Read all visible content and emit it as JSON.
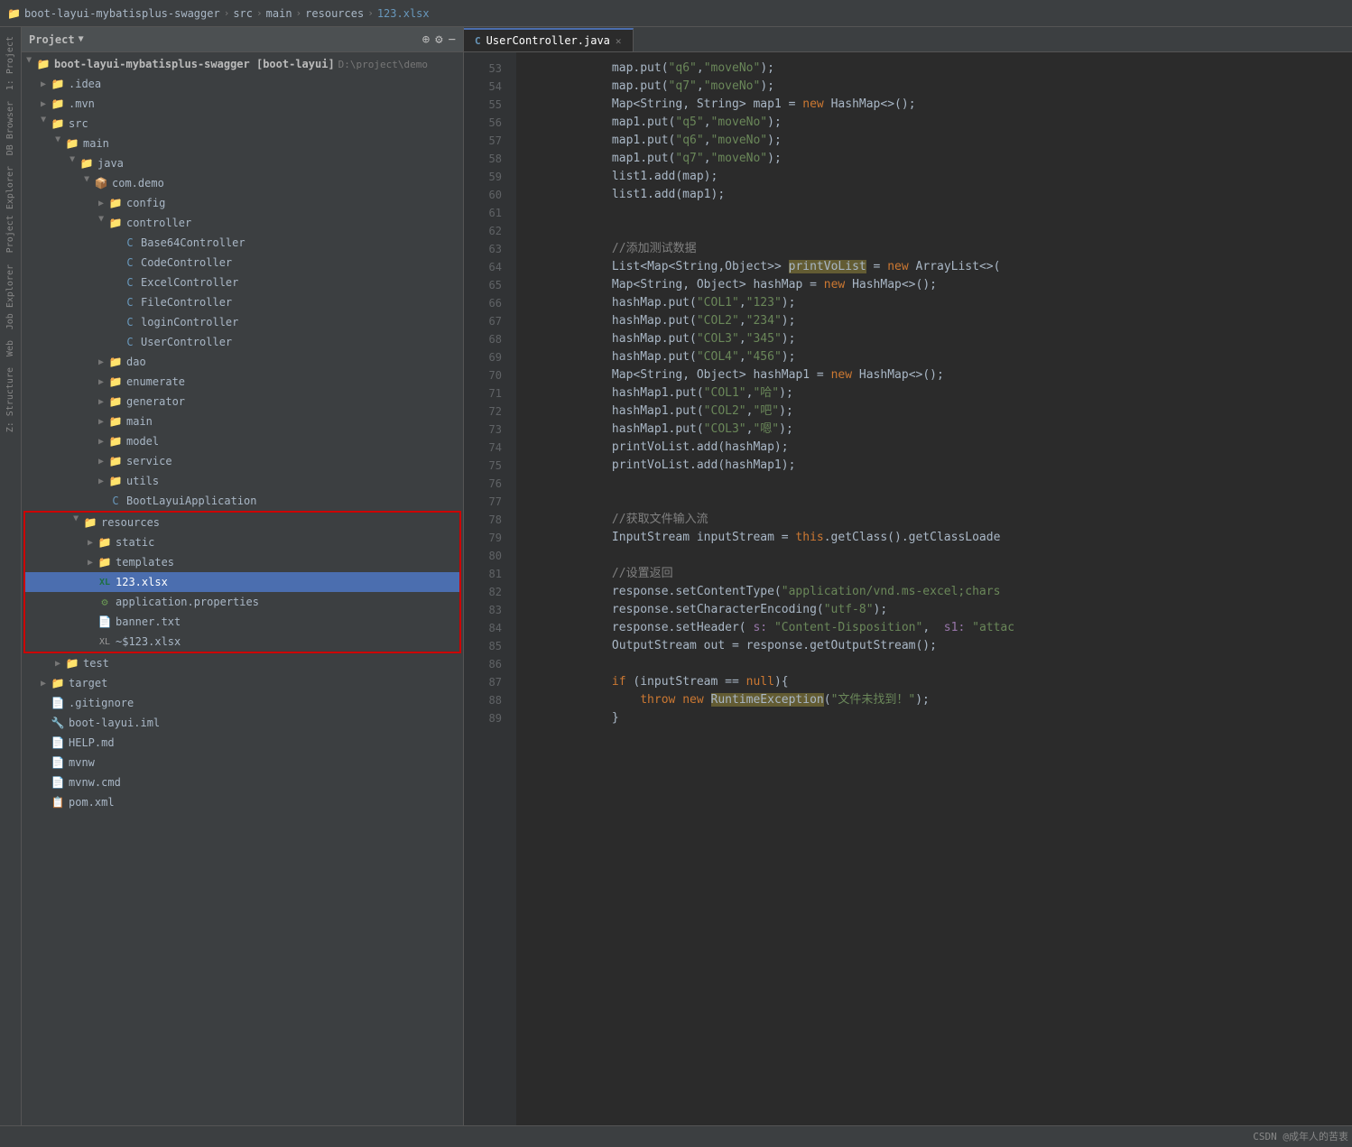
{
  "breadcrumb": {
    "items": [
      {
        "label": "boot-layui-mybatisplus-swagger",
        "active": false
      },
      {
        "label": "src",
        "active": false
      },
      {
        "label": "main",
        "active": false
      },
      {
        "label": "resources",
        "active": false
      },
      {
        "label": "123.xlsx",
        "active": true
      }
    ]
  },
  "panel": {
    "title": "Project",
    "toolbar": {
      "locate": "⊕",
      "settings": "⚙",
      "close": "−"
    }
  },
  "tree": {
    "root": "boot-layui-mybatisplus-swagger [boot-layui]",
    "rootPath": "D:\\project\\demo",
    "items": [
      {
        "id": "idea",
        "label": ".idea",
        "level": 1,
        "type": "folder",
        "expanded": false
      },
      {
        "id": "mvn",
        "label": ".mvn",
        "level": 1,
        "type": "folder",
        "expanded": false
      },
      {
        "id": "src",
        "label": "src",
        "level": 1,
        "type": "folder-src",
        "expanded": true
      },
      {
        "id": "main",
        "label": "main",
        "level": 2,
        "type": "folder",
        "expanded": true
      },
      {
        "id": "java",
        "label": "java",
        "level": 3,
        "type": "folder",
        "expanded": true
      },
      {
        "id": "comdemo",
        "label": "com.demo",
        "level": 4,
        "type": "pkg",
        "expanded": true
      },
      {
        "id": "config",
        "label": "config",
        "level": 5,
        "type": "folder",
        "expanded": false
      },
      {
        "id": "controller",
        "label": "controller",
        "level": 5,
        "type": "folder",
        "expanded": true
      },
      {
        "id": "Base64Controller",
        "label": "Base64Controller",
        "level": 6,
        "type": "class"
      },
      {
        "id": "CodeController",
        "label": "CodeController",
        "level": 6,
        "type": "class"
      },
      {
        "id": "ExcelController",
        "label": "ExcelController",
        "level": 6,
        "type": "class"
      },
      {
        "id": "FileController",
        "label": "FileController",
        "level": 6,
        "type": "class"
      },
      {
        "id": "loginController",
        "label": "loginController",
        "level": 6,
        "type": "class"
      },
      {
        "id": "UserController",
        "label": "UserController",
        "level": 6,
        "type": "class"
      },
      {
        "id": "dao",
        "label": "dao",
        "level": 5,
        "type": "folder",
        "expanded": false
      },
      {
        "id": "enumerate",
        "label": "enumerate",
        "level": 5,
        "type": "folder",
        "expanded": false
      },
      {
        "id": "generator",
        "label": "generator",
        "level": 5,
        "type": "folder",
        "expanded": false
      },
      {
        "id": "main2",
        "label": "main",
        "level": 5,
        "type": "folder",
        "expanded": false
      },
      {
        "id": "model",
        "label": "model",
        "level": 5,
        "type": "folder",
        "expanded": false
      },
      {
        "id": "service",
        "label": "service",
        "level": 5,
        "type": "folder",
        "expanded": false
      },
      {
        "id": "utils",
        "label": "utils",
        "level": 5,
        "type": "folder",
        "expanded": false
      },
      {
        "id": "BootLayuiApplication",
        "label": "BootLayuiApplication",
        "level": 5,
        "type": "class"
      },
      {
        "id": "resources",
        "label": "resources",
        "level": 3,
        "type": "folder",
        "expanded": true,
        "inBox": true
      },
      {
        "id": "static",
        "label": "static",
        "level": 4,
        "type": "folder",
        "expanded": false,
        "inBox": true
      },
      {
        "id": "templates",
        "label": "templates",
        "level": 4,
        "type": "folder",
        "expanded": false,
        "inBox": true
      },
      {
        "id": "123xlsx",
        "label": "123.xlsx",
        "level": 4,
        "type": "xlsx",
        "selected": true,
        "inBox": true
      },
      {
        "id": "applicationProperties",
        "label": "application.properties",
        "level": 4,
        "type": "properties",
        "inBox": true
      },
      {
        "id": "bannertxt",
        "label": "banner.txt",
        "level": 4,
        "type": "txt",
        "inBox": true
      },
      {
        "id": "123xlsxtmp",
        "label": "~$123.xlsx",
        "level": 4,
        "type": "xlsx-tmp",
        "inBox": true
      },
      {
        "id": "test",
        "label": "test",
        "level": 2,
        "type": "folder",
        "expanded": false
      },
      {
        "id": "target",
        "label": "target",
        "level": 1,
        "type": "folder",
        "expanded": false
      },
      {
        "id": "gitignore",
        "label": ".gitignore",
        "level": 1,
        "type": "txt"
      },
      {
        "id": "bootlayuiiml",
        "label": "boot-layui.iml",
        "level": 1,
        "type": "xml"
      },
      {
        "id": "helpmd",
        "label": "HELP.md",
        "level": 1,
        "type": "txt"
      },
      {
        "id": "mvnw",
        "label": "mvnw",
        "level": 1,
        "type": "txt"
      },
      {
        "id": "mvnwcmd",
        "label": "mvnw.cmd",
        "level": 1,
        "type": "txt"
      },
      {
        "id": "pomxml",
        "label": "pom.xml",
        "level": 1,
        "type": "xml"
      }
    ]
  },
  "editor": {
    "tab": "UserController.java",
    "lines": [
      {
        "num": 53,
        "code": "            map.put(\"q6\",\"moveNo\");"
      },
      {
        "num": 54,
        "code": "            map.put(\"q7\",\"moveNo\");"
      },
      {
        "num": 55,
        "code": "            Map<String, String> map1 = new HashMap<>();"
      },
      {
        "num": 56,
        "code": "            map1.put(\"q5\",\"moveNo\");"
      },
      {
        "num": 57,
        "code": "            map1.put(\"q6\",\"moveNo\");"
      },
      {
        "num": 58,
        "code": "            map1.put(\"q7\",\"moveNo\");"
      },
      {
        "num": 59,
        "code": "            list1.add(map);"
      },
      {
        "num": 60,
        "code": "            list1.add(map1);"
      },
      {
        "num": 61,
        "code": ""
      },
      {
        "num": 62,
        "code": ""
      },
      {
        "num": 63,
        "code": "            //添加测试数据"
      },
      {
        "num": 64,
        "code": "            List<Map<String,Object>> printVoList = new ArrayList<>("
      },
      {
        "num": 65,
        "code": "            Map<String, Object> hashMap = new HashMap<>();"
      },
      {
        "num": 66,
        "code": "            hashMap.put(\"COL1\",\"123\");"
      },
      {
        "num": 67,
        "code": "            hashMap.put(\"COL2\",\"234\");"
      },
      {
        "num": 68,
        "code": "            hashMap.put(\"COL3\",\"345\");"
      },
      {
        "num": 69,
        "code": "            hashMap.put(\"COL4\",\"456\");"
      },
      {
        "num": 70,
        "code": "            Map<String, Object> hashMap1 = new HashMap<>();"
      },
      {
        "num": 71,
        "code": "            hashMap1.put(\"COL1\",\"哈\");"
      },
      {
        "num": 72,
        "code": "            hashMap1.put(\"COL2\",\"吧\");"
      },
      {
        "num": 73,
        "code": "            hashMap1.put(\"COL3\",\"嗯\");"
      },
      {
        "num": 74,
        "code": "            printVoList.add(hashMap);"
      },
      {
        "num": 75,
        "code": "            printVoList.add(hashMap1);"
      },
      {
        "num": 76,
        "code": ""
      },
      {
        "num": 77,
        "code": ""
      },
      {
        "num": 78,
        "code": "            //获取文件输入流"
      },
      {
        "num": 79,
        "code": "            InputStream inputStream = this.getClass().getClassLoade"
      },
      {
        "num": 80,
        "code": ""
      },
      {
        "num": 81,
        "code": "            //设置返回"
      },
      {
        "num": 82,
        "code": "            response.setContentType(\"application/vnd.ms-excel;chars"
      },
      {
        "num": 83,
        "code": "            response.setCharacterEncoding(\"utf-8\");"
      },
      {
        "num": 84,
        "code": "            response.setHeader( s: \"Content-Disposition\",  s1: \"attac"
      },
      {
        "num": 85,
        "code": "            OutputStream out = response.getOutputStream();"
      },
      {
        "num": 86,
        "code": ""
      },
      {
        "num": 87,
        "code": "            if (inputStream == null){"
      },
      {
        "num": 88,
        "code": "                throw new RuntimeException(\"文件未找到！\");"
      },
      {
        "num": 89,
        "code": "            }"
      }
    ]
  },
  "sidebar_left": {
    "tabs": [
      "1: Project",
      "DB Browser",
      "Project Explorer",
      "Job Explorer",
      "Web",
      "Z: Structure"
    ]
  },
  "watermark": "CSDN @成年人的苦衷"
}
